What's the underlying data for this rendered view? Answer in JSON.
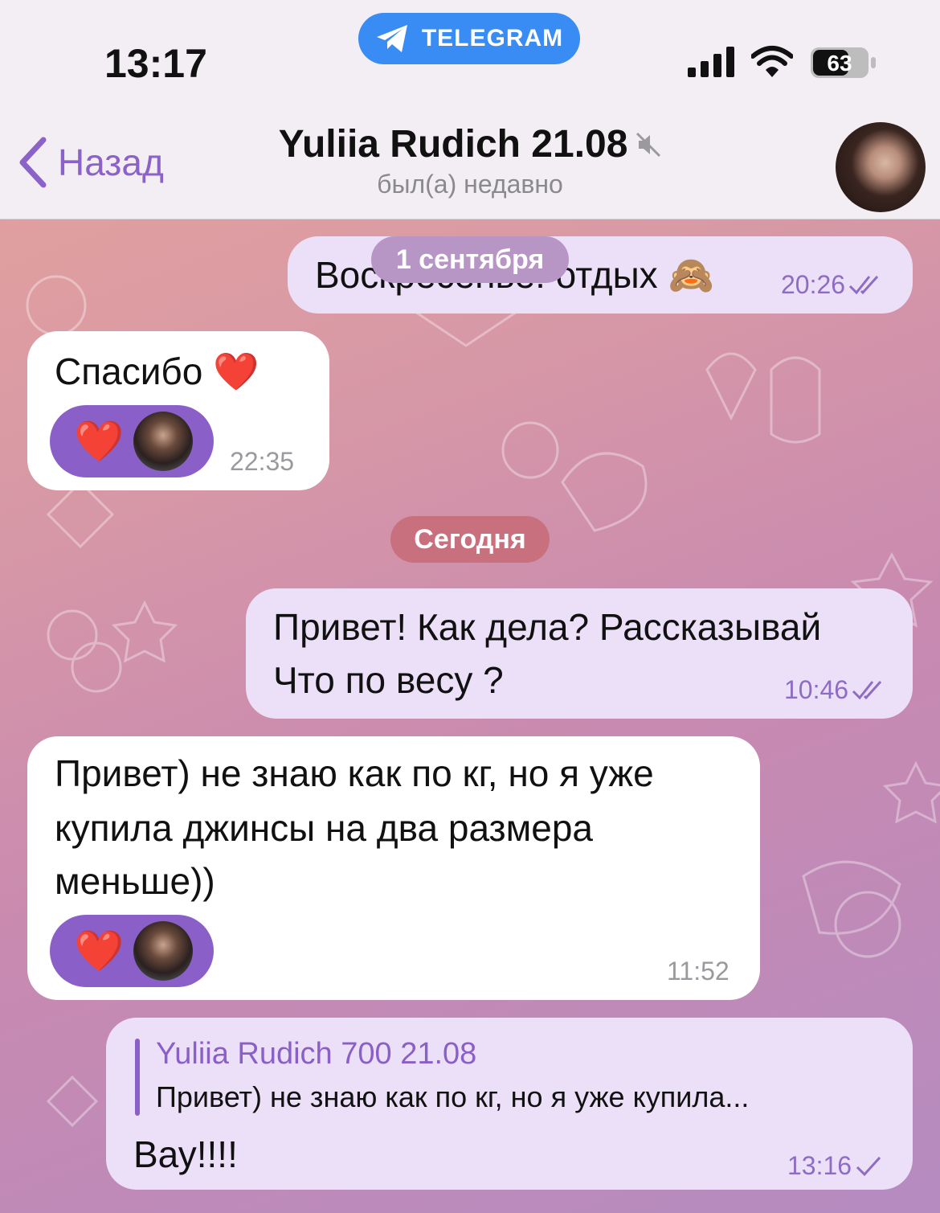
{
  "status_bar": {
    "time": "13:17",
    "app_pill_label": "TELEGRAM",
    "battery": "63"
  },
  "header": {
    "back_label": "Назад",
    "title": "Yuliia Rudich 21.08",
    "subtitle": "был(а) недавно"
  },
  "floating_date": "1 сентября",
  "messages": [
    {
      "direction": "out",
      "text": "Воскресенье: отдых 🙈",
      "time": "20:26",
      "status": "read"
    },
    {
      "direction": "in",
      "text": "Спасибо ❤️",
      "time": "22:35",
      "reaction": "❤️"
    },
    {
      "direction": "out",
      "lines": [
        "Привет! Как дела? Рассказывай",
        "Что по весу ?"
      ],
      "time": "10:46",
      "status": "read"
    },
    {
      "direction": "in",
      "lines": [
        "Привет) не знаю как по кг, но я уже",
        "купила джинсы на два размера",
        "меньше))"
      ],
      "time": "11:52",
      "reaction": "❤️"
    },
    {
      "direction": "out",
      "reply_to": {
        "name": "Yuliia Rudich 700 21.08",
        "text": "Привет) не знаю как по кг, но я уже купила..."
      },
      "text": "Вау!!!!",
      "time": "13:16",
      "status": "sent"
    }
  ],
  "date_separator": "Сегодня",
  "colors": {
    "accent": "#8a5fc8",
    "outgoing_bubble": "#ece0f8",
    "incoming_bubble": "#ffffff",
    "telegram_pill": "#3a8cf5",
    "date_pill_today": "#c9707e",
    "date_pill_floating": "#b796c6"
  },
  "icons": {
    "tg-pill": "telegram-plane-icon",
    "back": "chevron-left-icon",
    "mute": "muted-speaker-icon",
    "signal": "cellular-signal-icon",
    "wifi": "wifi-icon",
    "battery": "battery-icon",
    "check": "double-check-icon"
  }
}
